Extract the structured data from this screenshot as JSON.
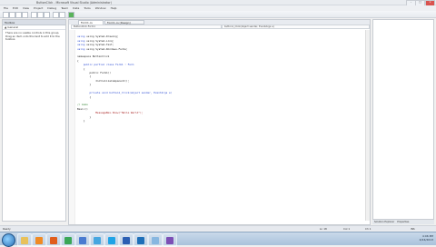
{
  "window": {
    "title": "ButtonClick - Microsoft Visual Studio (Administrator)",
    "controls": [
      "–",
      "□",
      "×"
    ]
  },
  "menu": [
    "File",
    "Edit",
    "View",
    "Project",
    "Debug",
    "Team",
    "Data",
    "Tools",
    "Window",
    "Help"
  ],
  "toolbox": {
    "title": "Toolbox",
    "section": "▲ General",
    "help": "There are no usable controls in this group. Drag an item onto this text to add it to the toolbox."
  },
  "editor": {
    "tabs": [
      "Form1.cs",
      "Form1.cs [Design]"
    ],
    "dropdown_left": "ButtonClick.Form1",
    "dropdown_right": "button1_Click(object sender, EventArgs e)"
  },
  "code": [
    "using System.Drawing;",
    "using System.Linq;",
    "using System.Text;",
    "using System.Windows.Forms;",
    "",
    "namespace ButtonClick",
    "{",
    "    public partial class Form1 : Form",
    "    {",
    "        public Form1()",
    "        {",
    "            InitializeComponent();",
    "        }",
    "",
    "        private void button1_Click(object sender, EventArgs e)",
    "        {",
    "",
    "// memo",
    "Basic()",
    "            MessageBox.Show(\"Hello World\");",
    "        }",
    "    }"
  ],
  "status": {
    "left": "Ready",
    "ln": "Ln 18",
    "col": "Col 1",
    "ch": "Ch 1",
    "mode": "INS"
  },
  "right_tabs": [
    "Solution Explorer",
    "Properties"
  ],
  "taskbar": {
    "apps": [
      {
        "name": "explorer-icon",
        "color": "#e8c15a"
      },
      {
        "name": "media-player-icon",
        "color": "#f08a24"
      },
      {
        "name": "firefox-icon",
        "color": "#e05d1c"
      },
      {
        "name": "chrome-icon",
        "color": "#3aa757"
      },
      {
        "name": "media-icon",
        "color": "#4a7bd0"
      },
      {
        "name": "messenger-icon",
        "color": "#46a6e0"
      },
      {
        "name": "skype-icon",
        "color": "#1fa3e6"
      },
      {
        "name": "word-icon",
        "color": "#2b5fb3"
      },
      {
        "name": "outlook-icon",
        "color": "#1e6fb8"
      },
      {
        "name": "notepad-icon",
        "color": "#88b7e0"
      },
      {
        "name": "visual-studio-icon",
        "color": "#7c4fb5"
      }
    ],
    "time": "4:06 PM",
    "date": "4/24/2013"
  }
}
